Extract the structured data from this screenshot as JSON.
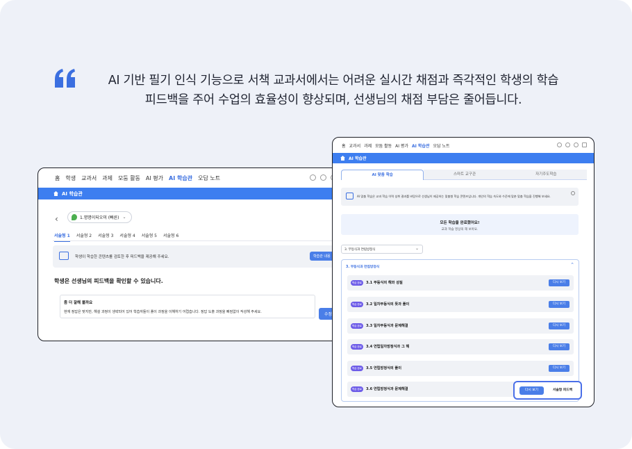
{
  "quote": {
    "line1": "AI 기반 필기 인식 기능으로 서책 교과서에서는 어려운 실시간 채점과 즉각적인 학생의 학습",
    "line2": "피드백을 주어 수업의 효율성이 향상되며, 선생님의 채점 부담은 줄어듭니다."
  },
  "colors": {
    "accent": "#3d7ef0",
    "badge": "#6d5ce8",
    "quote_mark": "#3b6fe0"
  },
  "left_window": {
    "nav": [
      "홈",
      "학생",
      "교과서",
      "과제",
      "모둠 활동",
      "AI 평가",
      "AI 학습관",
      "오답 노트"
    ],
    "nav_active": "AI 학습관",
    "bar_title": "AI 학습관",
    "book_label": "1.명명이되오미 (빠른)",
    "tabs": [
      "서술형 1",
      "서술형 2",
      "서술형 3",
      "서술형 4",
      "서술형 5",
      "서술형 6"
    ],
    "info_text": "학생이 학습한 콘텐츠를 검토한 후 피드백을 제공해 주세요.",
    "info_button": "학습관 내용",
    "heading": "학생은 선생님의 피드백을 확인할 수 있습니다.",
    "card_title": "좀 더 잘해 볼까요",
    "card_body": "현재 정답은 맞지만, 해설 과정이 생략되어 있어 학습자들이 풀이 과정을 이해하기 어렵습니다. 정답 도출 과정을 빠짐없이 작성해 주세요.",
    "card_button": "수정"
  },
  "right_window": {
    "nav": [
      "홈",
      "교과서",
      "과제",
      "모둠 활동",
      "AI 평가",
      "AI 학습관",
      "오답 노트"
    ],
    "nav_active": "AI 학습관",
    "bar_title": "AI 학습관",
    "tabs": [
      "AI 맞춤 학습",
      "스마트 교구관",
      "자기주도학습"
    ],
    "info_text": "AI 맞춤 학습은 교과 학습 이력 성취 결과를 바탕으로 선생님이 제공하는 맞춤형 학습 콘텐츠입니다. 개인의 학습 속도와 수준에 맞춘 맞춤 학습을 진행해 보세요.",
    "done_title": "모든 학습을 완료했어요!",
    "done_sub": "교과 학습 영상의 해 보아요.",
    "select_value": "3. 부등식과 연립방정식",
    "unit_title": "3. 부등식과 연립방정식",
    "badge_label": "학습 완료",
    "rows": [
      "3.1 부등식의 해와 성질",
      "3.2 일차부등식의 뜻과 풀이",
      "3.3 일차부등식과 문제해결",
      "3.4 연립일차방정식과 그 해",
      "3.5 연립방정식의 풀이",
      "3.6 연립방정식과 문제해결"
    ],
    "row_button": "다시 보기",
    "highlight_primary": "다시 보기",
    "highlight_secondary": "서술형 피드백"
  }
}
